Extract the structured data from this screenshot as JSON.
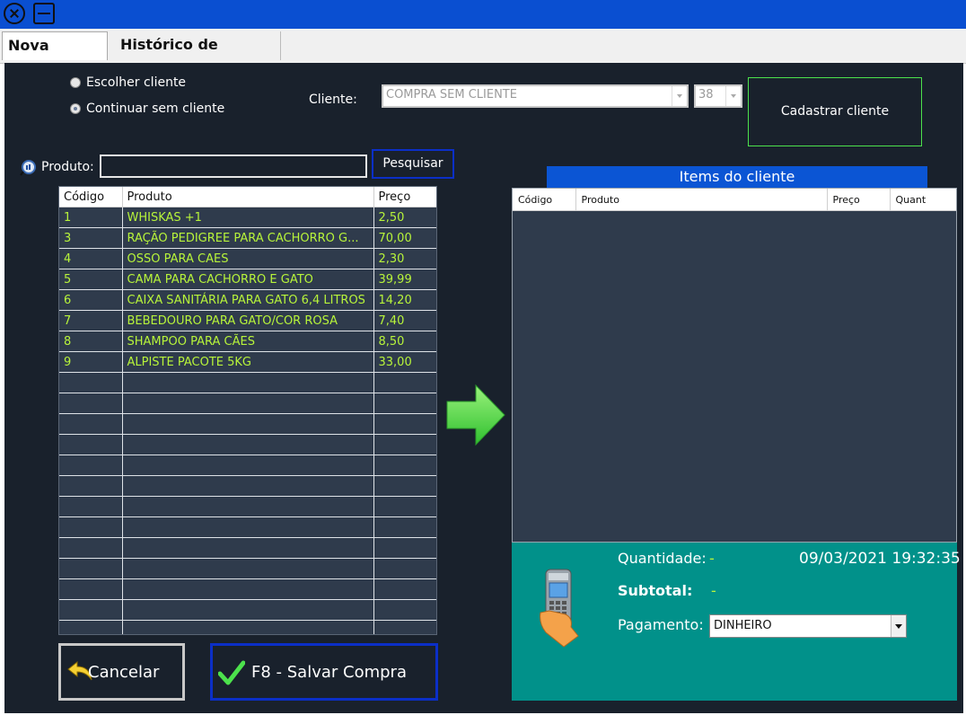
{
  "tabs": [
    {
      "label": "Nova Compra"
    },
    {
      "label": "Histórico de compras"
    }
  ],
  "client_options": {
    "choose_label": "Escolher cliente",
    "continue_label": "Continuar sem cliente",
    "selected": "Continuar sem cliente"
  },
  "client": {
    "label": "Cliente:",
    "name_value": "COMPRA SEM CLIENTE",
    "code_value": "38",
    "register_button": "Cadastrar cliente"
  },
  "product_search": {
    "label": "Produto:",
    "value": "",
    "search_button": "Pesquisar"
  },
  "products_table": {
    "columns": [
      "Código",
      "Produto",
      "Preço"
    ],
    "rows": [
      [
        "1",
        "WHISKAS +1",
        "2,50"
      ],
      [
        "3",
        "RAÇÃO PEDIGREE PARA CACHORRO G...",
        "70,00"
      ],
      [
        "4",
        "OSSO PARA CAES",
        "2,30"
      ],
      [
        "5",
        "CAMA PARA CACHORRO E GATO",
        "39,99"
      ],
      [
        "6",
        "CAIXA SANITÁRIA PARA GATO 6,4 LITROS",
        "14,20"
      ],
      [
        "7",
        "BEBEDOURO PARA GATO/COR ROSA",
        "7,40"
      ],
      [
        "8",
        "SHAMPOO PARA CÃES",
        "8,50"
      ],
      [
        "9",
        "ALPISTE PACOTE 5KG",
        "33,00"
      ]
    ]
  },
  "items_panel": {
    "title": "Items do cliente",
    "columns": [
      "Código",
      "Produto",
      "Preço",
      "Quant"
    ]
  },
  "summary": {
    "quantity_label": "Quantidade:",
    "quantity_value": "-",
    "datetime": "09/03/2021 19:32:35",
    "subtotal_label": "Subtotal:",
    "subtotal_value": "-",
    "payment_label": "Pagamento:",
    "payment_value": "DINHEIRO"
  },
  "actions": {
    "cancel_label": "Cancelar",
    "save_label": "F8 - Salvar Compra"
  },
  "icons": {
    "add_arrow": "right-arrow-icon",
    "payment": "card-terminal-icon",
    "cancel": "undo-arrow-icon",
    "save": "checkmark-icon",
    "search": "search-icon"
  },
  "colors": {
    "titlebar": "#0a4fd1",
    "panel": "#19212c",
    "product_text": "#b8f53a",
    "summary_bg": "#01918a",
    "accent_green": "#4ce24c",
    "accent_blue": "#0b55d4"
  }
}
